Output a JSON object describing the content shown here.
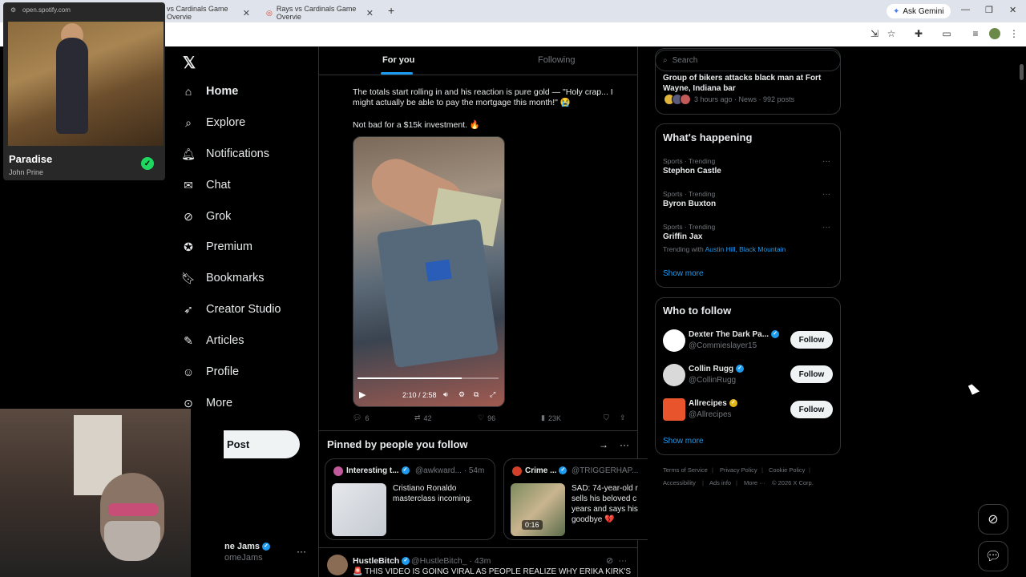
{
  "browser": {
    "tabs": [
      {
        "label": "vs Cardinals Game Overvie"
      },
      {
        "label": "Rays vs Cardinals Game Overvie"
      }
    ],
    "new_tab": "+",
    "ask_gemini": "Ask Gemini"
  },
  "spotify": {
    "url": "open.spotify.com",
    "track": "Paradise",
    "artist": "John Prine"
  },
  "nav": {
    "logo": "𝕏",
    "items": [
      {
        "label": "Home",
        "icon": "home-icon"
      },
      {
        "label": "Explore",
        "icon": "search-icon"
      },
      {
        "label": "Notifications",
        "icon": "bell-icon"
      },
      {
        "label": "Chat",
        "icon": "mail-icon"
      },
      {
        "label": "Grok",
        "icon": "grok-icon"
      },
      {
        "label": "Premium",
        "icon": "premium-icon"
      },
      {
        "label": "Bookmarks",
        "icon": "bookmark-icon"
      },
      {
        "label": "Creator Studio",
        "icon": "rocket-icon"
      },
      {
        "label": "Articles",
        "icon": "articles-icon"
      },
      {
        "label": "Profile",
        "icon": "person-icon"
      },
      {
        "label": "More",
        "icon": "more-icon"
      }
    ],
    "post_button": "Post",
    "account_name": "ne Jams",
    "account_handle": "omeJams"
  },
  "timeline": {
    "tabs": [
      "For you",
      "Following"
    ],
    "tweet": {
      "text1": "The totals start rolling in and his reaction is pure gold — \"Holy crap... I might actually be able to pay the mortgage this month!\" 😭",
      "text2": "Not bad for a $15k investment. 🔥",
      "video_time": "2:10 / 2:58",
      "video_progress": 0.74,
      "replies": "6",
      "reposts": "42",
      "likes": "96",
      "views": "23K"
    },
    "pinned": {
      "header": "Pinned by people you follow",
      "cards": [
        {
          "name": "Interesting t...",
          "handle": "@awkward... · 54m",
          "text": "Cristiano Ronaldo masterclass incoming."
        },
        {
          "name": "Crime ...",
          "handle": "@TRIGGERHAP...",
          "text": "SAD: 74-year-old r sells his beloved c years and says his goodbye 💔",
          "duration": "0:16"
        }
      ]
    },
    "tweet2": {
      "name": "HustleBitch",
      "handle": "@HustleBitch_ · 43m",
      "text": "🚨 THIS VIDEO IS GOING VIRAL AS PEOPLE REALIZE WHY ERIKA KIRK'S"
    }
  },
  "sidebar": {
    "search_placeholder": "Search",
    "news": {
      "title": "Group of bikers attacks black man at Fort Wayne, Indiana bar",
      "meta": "3 hours ago · News · 992 posts"
    },
    "happening": {
      "title": "What's happening",
      "trends": [
        {
          "meta": "Sports · Trending",
          "name": "Stephon Castle"
        },
        {
          "meta": "Sports · Trending",
          "name": "Byron Buxton"
        },
        {
          "meta": "Sports · Trending",
          "name": "Griffin Jax"
        }
      ],
      "trending_with_prefix": "Trending with",
      "trending_with_1": "Austin Hill",
      "trending_with_2": "Black Mountain",
      "show_more": "Show more"
    },
    "who_to_follow": {
      "title": "Who to follow",
      "accounts": [
        {
          "name": "Dexter The Dark Pa...",
          "handle": "@Commieslayer15",
          "button": "Follow"
        },
        {
          "name": "Collin Rugg",
          "handle": "@CollinRugg",
          "button": "Follow"
        },
        {
          "name": "Allrecipes",
          "handle": "@Allrecipes",
          "button": "Follow"
        }
      ],
      "show_more": "Show more"
    },
    "footer": {
      "terms": "Terms of Service",
      "privacy": "Privacy Policy",
      "cookie": "Cookie Policy",
      "accessibility": "Accessibility",
      "ads": "Ads info",
      "more": "More ···",
      "copyright": "© 2026 X Corp."
    }
  },
  "colors": {
    "accent": "#1d9bf0",
    "background": "#000000",
    "border": "#2f3336",
    "spotify_green": "#1ed760"
  }
}
